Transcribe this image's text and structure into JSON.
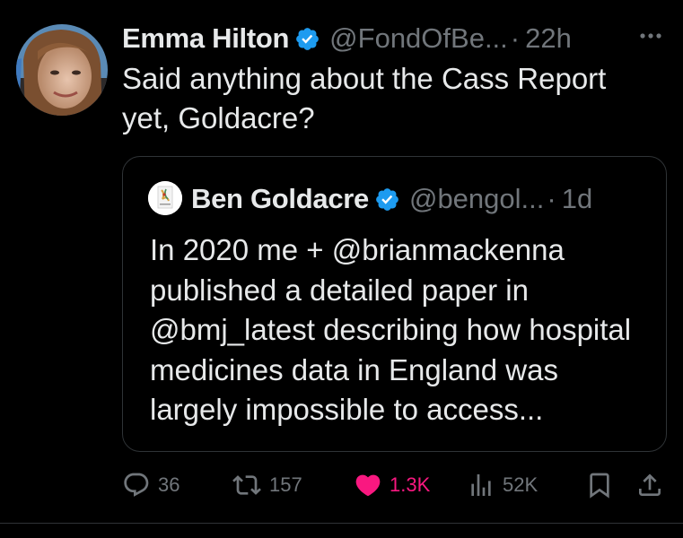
{
  "tweet": {
    "author_name": "Emma Hilton",
    "author_handle": "@FondOfBe...",
    "separator": "·",
    "time": "22h",
    "text": "Said anything about the Cass Report yet, Goldacre?",
    "more_icon": "more-horizontal-icon"
  },
  "quote": {
    "author_name": "Ben Goldacre",
    "author_handle": "@bengol...",
    "separator": "·",
    "time": "1d",
    "text": "In 2020 me + @brianmackenna published a detailed paper in @bmj_latest describing how hospital medicines data in England was largely impossible to access..."
  },
  "actions": {
    "replies": "36",
    "reposts": "157",
    "likes": "1.3K",
    "views": "52K",
    "liked": true
  },
  "colors": {
    "background": "#000000",
    "text": "#e7e9ea",
    "muted": "#71767b",
    "verified": "#1d9bf0",
    "like": "#f91880",
    "border": "#2f3336"
  }
}
